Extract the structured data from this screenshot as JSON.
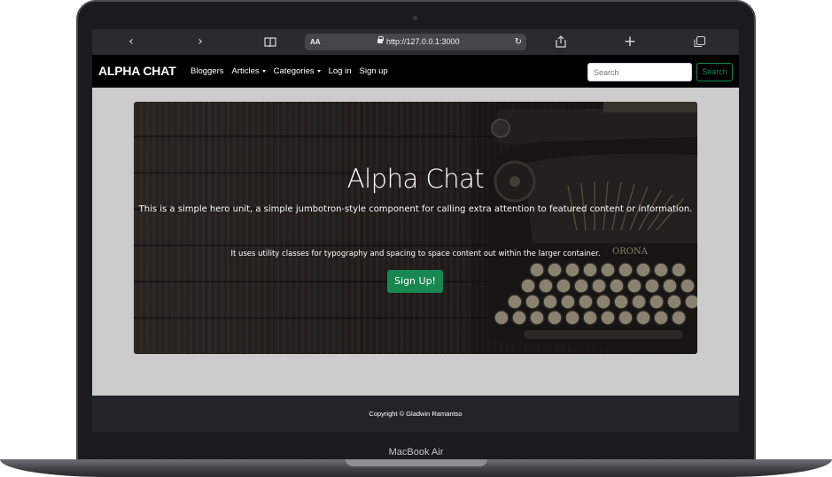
{
  "device": {
    "label": "MacBook Air"
  },
  "browser": {
    "reader_label": "AA",
    "url": "http://127.0.0.1:3000",
    "icons": [
      "back-icon",
      "forward-icon",
      "book-icon",
      "reload-icon",
      "share-icon",
      "plus-icon",
      "tabs-icon"
    ]
  },
  "navbar": {
    "brand": "ALPHA CHAT",
    "links": [
      {
        "label": "Bloggers"
      },
      {
        "label": "Articles"
      },
      {
        "label": "Categories"
      },
      {
        "label": "Log in"
      },
      {
        "label": "Sign up"
      }
    ],
    "search_placeholder": "Search",
    "search_button": "Search"
  },
  "hero": {
    "title": "Alpha Chat",
    "lead": "This is a simple hero unit, a simple jumbotron-style component for calling extra attention to featured content or information.",
    "text": "It uses utility classes for typography and spacing to space content out within the larger container.",
    "button": "Sign Up!",
    "image_lettering": "ORONA"
  },
  "footer": {
    "copyright": "Copyright © Gladwin Ramantso"
  },
  "colors": {
    "accent": "#198754",
    "navbar": "#000000",
    "footer": "#212529",
    "page_bg": "#cccccc"
  }
}
